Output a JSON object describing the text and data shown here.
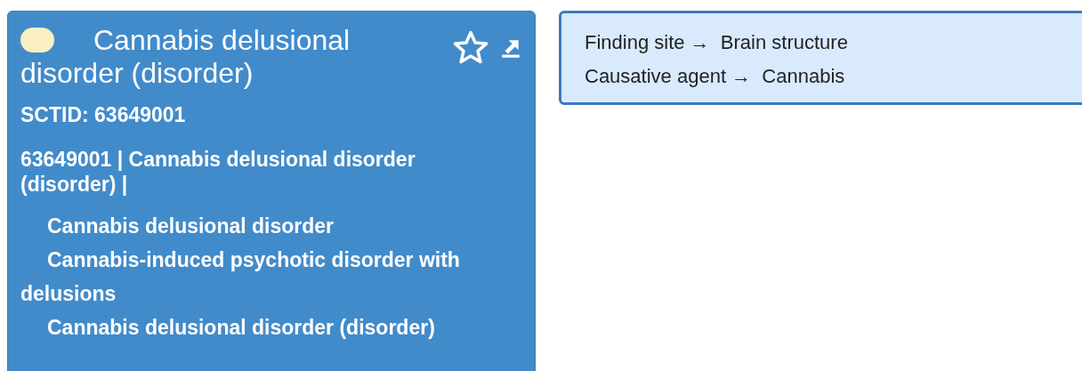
{
  "concept_card": {
    "primitive": true,
    "title": "Cannabis delusional disorder (disorder)",
    "favorite": false,
    "sctid": "SCTID: 63649001",
    "fsn_line": "63649001 | Cannabis delusional disorder (disorder) |",
    "descriptions": [
      "Cannabis delusional disorder",
      "Cannabis-induced psychotic disorder with delusions",
      "Cannabis delusional disorder (disorder)"
    ]
  },
  "attributes_panel": {
    "lines": [
      "Finding site →  Brain structure",
      "Causative agent →  Cannabis"
    ]
  }
}
